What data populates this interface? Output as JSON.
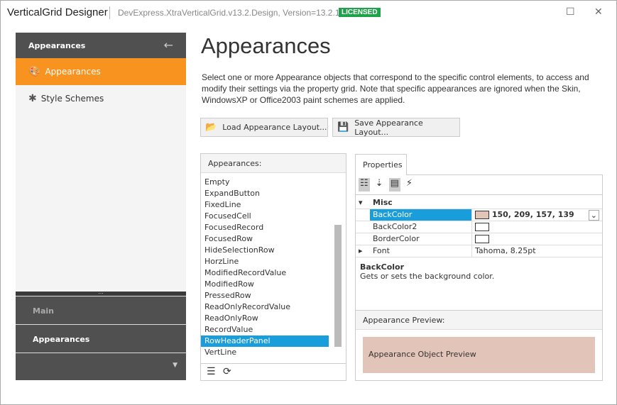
{
  "window": {
    "title": "VerticalGrid Designer",
    "subtitle": "DevExpress.XtraVerticalGrid.v13.2.Design, Version=13.2.1.0",
    "badge": "LICENSED",
    "badge_color": "#1fa34a",
    "maximize": "☐",
    "close": "✕"
  },
  "sidebar": {
    "header": "Appearances",
    "back_icon": "←",
    "items": [
      {
        "label": "Appearances",
        "icon": "palette-icon",
        "selected": true
      },
      {
        "label": "Style Schemes",
        "icon": "style-icon"
      }
    ],
    "groups": [
      "Main",
      "Appearances"
    ],
    "accent": "#f7931e"
  },
  "main": {
    "title": "Appearances",
    "description": "Select one or more Appearance objects that correspond to the specific control elements, to access and modify their settings via the property grid. Note that specific appearances are ignored when the Skin, WindowsXP or Office2003 paint schemes are applied.",
    "load_button": "Load Appearance Layout...",
    "save_button": "Save Appearance Layout...",
    "list_header": "Appearances:",
    "list": [
      "Empty",
      "ExpandButton",
      "FixedLine",
      "FocusedCell",
      "FocusedRecord",
      "FocusedRow",
      "HideSelectionRow",
      "HorzLine",
      "ModifiedRecordValue",
      "ModifiedRow",
      "PressedRow",
      "ReadOnlyRecordValue",
      "ReadOnlyRow",
      "RecordValue",
      "RowHeaderPanel",
      "VertLine"
    ],
    "selected_item": "RowHeaderPanel",
    "properties_tab": "Properties",
    "category": "Misc",
    "props": [
      {
        "name": "BackColor",
        "value": "150, 209, 157, 139",
        "swatch": "#e2c4b8",
        "selected": true
      },
      {
        "name": "BackColor2",
        "value": "",
        "swatch": "#ffffff"
      },
      {
        "name": "BorderColor",
        "value": "",
        "swatch": "#ffffff"
      },
      {
        "name": "Font",
        "value": "Tahoma, 8.25pt"
      }
    ],
    "desc_title": "BackColor",
    "desc_text": "Gets or sets the background color.",
    "preview_header": "Appearance Preview:",
    "preview_text": "Appearance Object Preview"
  }
}
